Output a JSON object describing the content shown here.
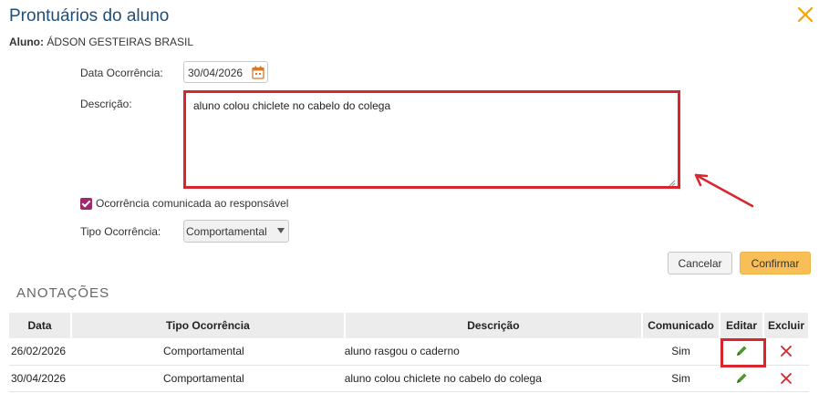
{
  "dialog": {
    "title": "Prontuários do aluno",
    "close_icon": "close-icon"
  },
  "student": {
    "label": "Aluno:",
    "name": "ÁDSON GESTEIRAS BRASIL"
  },
  "form": {
    "date_label": "Data Ocorrência:",
    "date_value": "30/04/2026",
    "description_label": "Descrição:",
    "description_value": "aluno colou chiclete no cabelo do colega",
    "notified_label": "Ocorrência comunicada ao responsável",
    "notified_checked": true,
    "type_label": "Tipo Ocorrência:",
    "type_value": "Comportamental"
  },
  "buttons": {
    "cancel": "Cancelar",
    "confirm": "Confirmar"
  },
  "annotations": {
    "title": "ANOTAÇÕES",
    "headers": [
      "Data",
      "Tipo Ocorrência",
      "Descrição",
      "Comunicado",
      "Editar",
      "Excluir"
    ],
    "rows": [
      {
        "date": "26/02/2026",
        "type": "Comportamental",
        "description": "aluno rasgou o caderno",
        "notified": "Sim"
      },
      {
        "date": "30/04/2026",
        "type": "Comportamental",
        "description": "aluno colou chiclete no cabelo do colega",
        "notified": "Sim"
      }
    ]
  },
  "colors": {
    "title": "#1f4e79",
    "close": "#f0a500",
    "highlight": "#d9252e",
    "checkbox": "#a0276c",
    "confirm_button": "#f9bf57",
    "edit_icon": "#4a9a2a",
    "delete_icon": "#d9252e"
  }
}
